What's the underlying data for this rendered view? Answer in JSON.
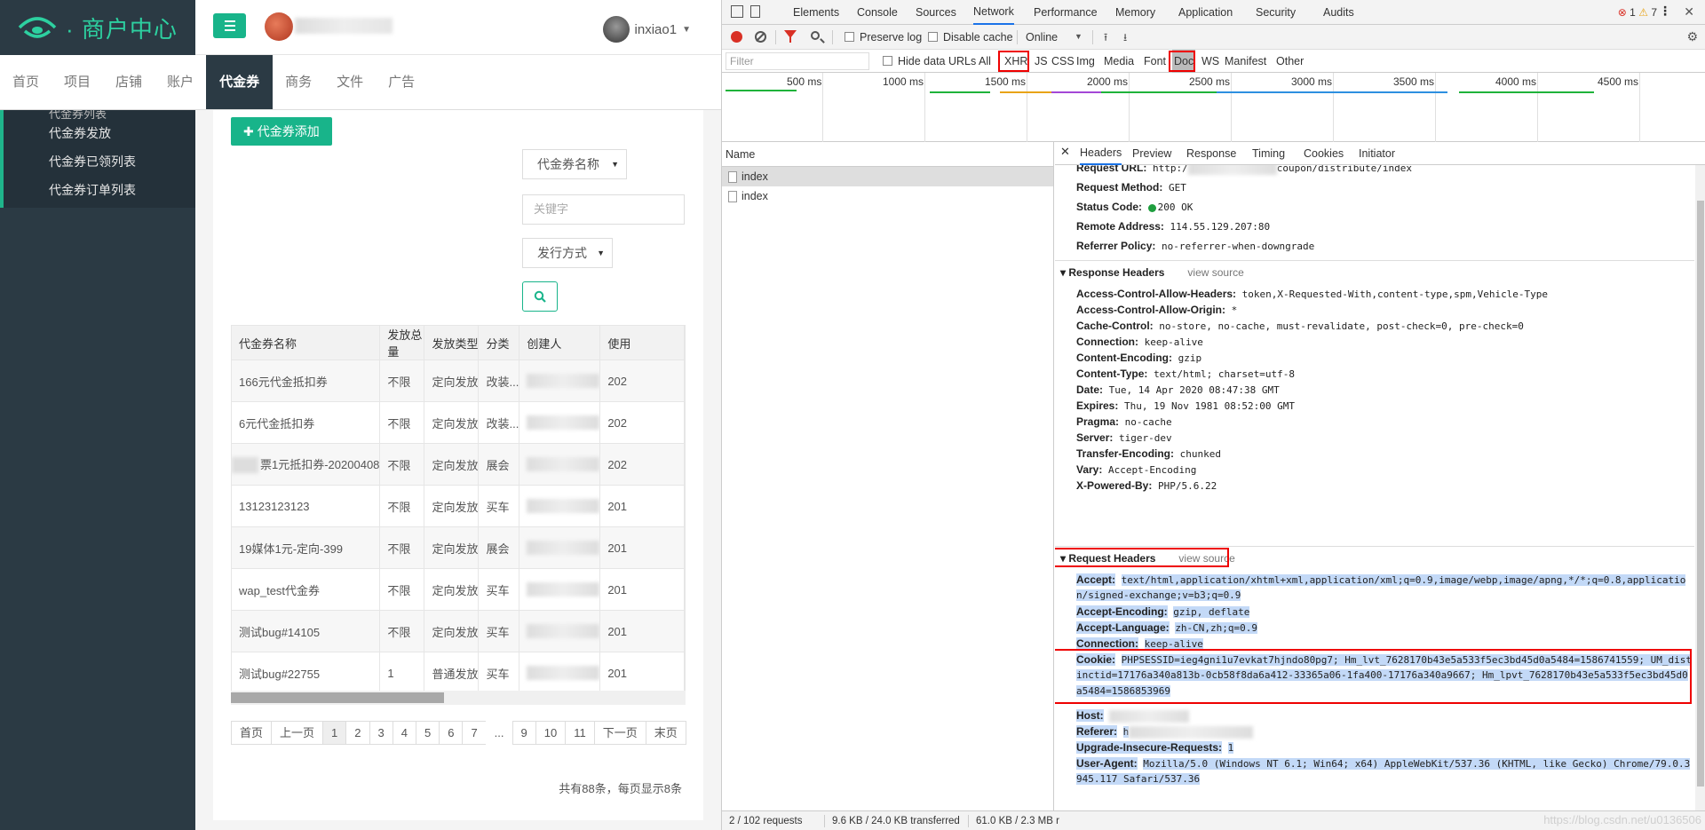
{
  "app": {
    "logo_text": "· 商户中心",
    "username": "inxiao1",
    "nav": [
      "首页",
      "项目",
      "店铺",
      "账户",
      "代金券",
      "商务",
      "文件",
      "广告"
    ],
    "nav_active_index": 4,
    "subnav": [
      "代金券列表",
      "代金券发放",
      "代金券已领列表",
      "代金券订单列表"
    ],
    "add_button": "代金券添加",
    "filter_name_select": "代金券名称",
    "keyword_placeholder": "关键字",
    "issue_type_select": "发行方式",
    "table": {
      "headers": [
        "代金券名称",
        "发放总量",
        "发放类型",
        "分类",
        "创建人",
        "使用"
      ],
      "rows": [
        [
          "166元代金抵扣券",
          "不限",
          "定向发放",
          "改装...",
          "",
          "202"
        ],
        [
          "6元代金抵扣券",
          "不限",
          "定向发放",
          "改装...",
          "",
          "202"
        ],
        [
          "票1元抵扣券-20200408",
          "不限",
          "定向发放",
          "展会",
          "",
          "202"
        ],
        [
          "13123123123",
          "不限",
          "定向发放",
          "买车",
          "",
          "201"
        ],
        [
          "19媒体1元-定向-399",
          "不限",
          "定向发放",
          "展会",
          "",
          "201"
        ],
        [
          "wap_test代金券",
          "不限",
          "定向发放",
          "买车",
          "",
          "201"
        ],
        [
          "测试bug#14105",
          "不限",
          "定向发放",
          "买车",
          "",
          "201"
        ],
        [
          "测试bug#22755",
          "1",
          "普通发放",
          "买车",
          "",
          "201"
        ]
      ]
    },
    "pager": [
      "首页",
      "上一页",
      "1",
      "2",
      "3",
      "4",
      "5",
      "6",
      "7",
      "...",
      "9",
      "10",
      "11",
      "下一页",
      "末页"
    ],
    "pager_active": "1",
    "summary": "共有88条，每页显示8条"
  },
  "devtools": {
    "tabs": [
      "Elements",
      "Console",
      "Sources",
      "Network",
      "Performance",
      "Memory",
      "Application",
      "Security",
      "Audits"
    ],
    "active_tab": "Network",
    "error_count": "1",
    "warning_count": "7",
    "toolbar": {
      "preserve_log": "Preserve log",
      "disable_cache": "Disable cache",
      "throttle": "Online"
    },
    "filter": {
      "placeholder": "Filter",
      "hide_data_urls": "Hide data URLs",
      "types": [
        "All",
        "XHR",
        "JS",
        "CSS",
        "Img",
        "Media",
        "Font",
        "Doc",
        "WS",
        "Manifest",
        "Other"
      ]
    },
    "timeline_labels": [
      "500 ms",
      "1000 ms",
      "1500 ms",
      "2000 ms",
      "2500 ms",
      "3000 ms",
      "3500 ms",
      "4000 ms",
      "4500 ms"
    ],
    "request_list": {
      "header": "Name",
      "rows": [
        "index",
        "index"
      ]
    },
    "detail_tabs": [
      "Headers",
      "Preview",
      "Response",
      "Timing",
      "Cookies",
      "Initiator"
    ],
    "general": {
      "request_url_label": "Request URL:",
      "request_url_prefix": "http:/",
      "request_url_suffix": "coupon/distribute/index",
      "request_method_label": "Request Method:",
      "request_method": "GET",
      "status_code_label": "Status Code:",
      "status_code": "200 OK",
      "remote_address_label": "Remote Address:",
      "remote_address": "114.55.129.207:80",
      "referrer_policy_label": "Referrer Policy:",
      "referrer_policy": "no-referrer-when-downgrade"
    },
    "response_headers_title": "Response Headers",
    "view_source": "view source",
    "response_headers": [
      [
        "Access-Control-Allow-Headers:",
        "token,X-Requested-With,content-type,spm,Vehicle-Type"
      ],
      [
        "Access-Control-Allow-Origin:",
        "*"
      ],
      [
        "Cache-Control:",
        "no-store, no-cache, must-revalidate, post-check=0, pre-check=0"
      ],
      [
        "Connection:",
        "keep-alive"
      ],
      [
        "Content-Encoding:",
        "gzip"
      ],
      [
        "Content-Type:",
        "text/html; charset=utf-8"
      ],
      [
        "Date:",
        "Tue, 14 Apr 2020 08:47:38 GMT"
      ],
      [
        "Expires:",
        "Thu, 19 Nov 1981 08:52:00 GMT"
      ],
      [
        "Pragma:",
        "no-cache"
      ],
      [
        "Server:",
        "tiger-dev"
      ],
      [
        "Transfer-Encoding:",
        "chunked"
      ],
      [
        "Vary:",
        "Accept-Encoding"
      ],
      [
        "X-Powered-By:",
        "PHP/5.6.22"
      ]
    ],
    "request_headers_title": "Request Headers",
    "request_headers": {
      "accept_label": "Accept:",
      "accept_1": "text/html,application/xhtml+xml,application/xml;q=0.9,image/webp,image/apng,*/*;q=0.8,applicatio",
      "accept_2": "n/signed-exchange;v=b3;q=0.9",
      "accept_encoding_label": "Accept-Encoding:",
      "accept_encoding": "gzip, deflate",
      "accept_language_label": "Accept-Language:",
      "accept_language": "zh-CN,zh;q=0.9",
      "connection_label": "Connection:",
      "connection": "keep-alive",
      "cookie_label": "Cookie:",
      "cookie_1": "PHPSESSID=ieg4gni1u7evkat7hjndo80pg7; Hm_lvt_7628170b43e5a533f5ec3bd45d0a5484=1586741559; UM_dist",
      "cookie_2": "inctid=17176a340a813b-0cb58f8da6a412-33365a06-1fa400-17176a340a9667; Hm_lpvt_7628170b43e5a533f5ec3bd45d0",
      "cookie_3": "a5484=1586853969",
      "host_label": "Host:",
      "referer_label": "Referer:",
      "referer_prefix": "h",
      "upgrade_label": "Upgrade-Insecure-Requests:",
      "upgrade": "1",
      "ua_label": "User-Agent:",
      "ua_1": "Mozilla/5.0 (Windows NT 6.1; Win64; x64) AppleWebKit/537.36 (KHTML, like Gecko) Chrome/79.0.3",
      "ua_2": "945.117 Safari/537.36"
    },
    "status_bar": {
      "requests": "2 / 102 requests",
      "transferred": "9.6 KB / 24.0 KB transferred",
      "resources": "61.0 KB / 2.3 MB r"
    },
    "watermark": "https://blog.csdn.net/u0136506"
  },
  "colors": {
    "brand_green": "#18b48a",
    "sidebar_dark": "#2b3a44",
    "devtools_blue": "#1a73e8",
    "highlight_red": "#e00000",
    "selection_blue": "#c3d9f7"
  }
}
